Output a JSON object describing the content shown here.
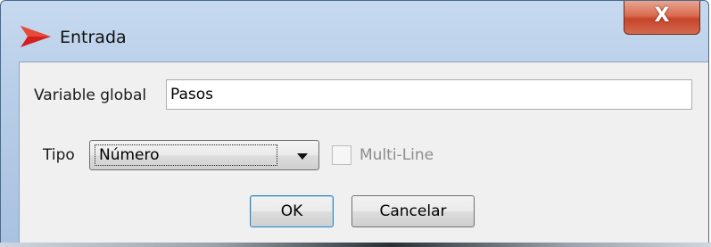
{
  "window": {
    "title": "Entrada",
    "close_glyph": "X",
    "icon": "red-arrow-icon"
  },
  "form": {
    "variable_label": "Variable global",
    "variable_value": "Pasos",
    "tipo_label": "Tipo",
    "tipo_selected": "Número",
    "multiline_label": "Multi-Line",
    "multiline_checked": false,
    "multiline_enabled": false
  },
  "buttons": {
    "ok_label": "OK",
    "cancel_label": "Cancelar"
  },
  "colors": {
    "accent_icon": "#d41f1f",
    "close_button": "#c6442a",
    "titlebar": "#b7cde8",
    "client_bg": "#f0f0f0"
  }
}
